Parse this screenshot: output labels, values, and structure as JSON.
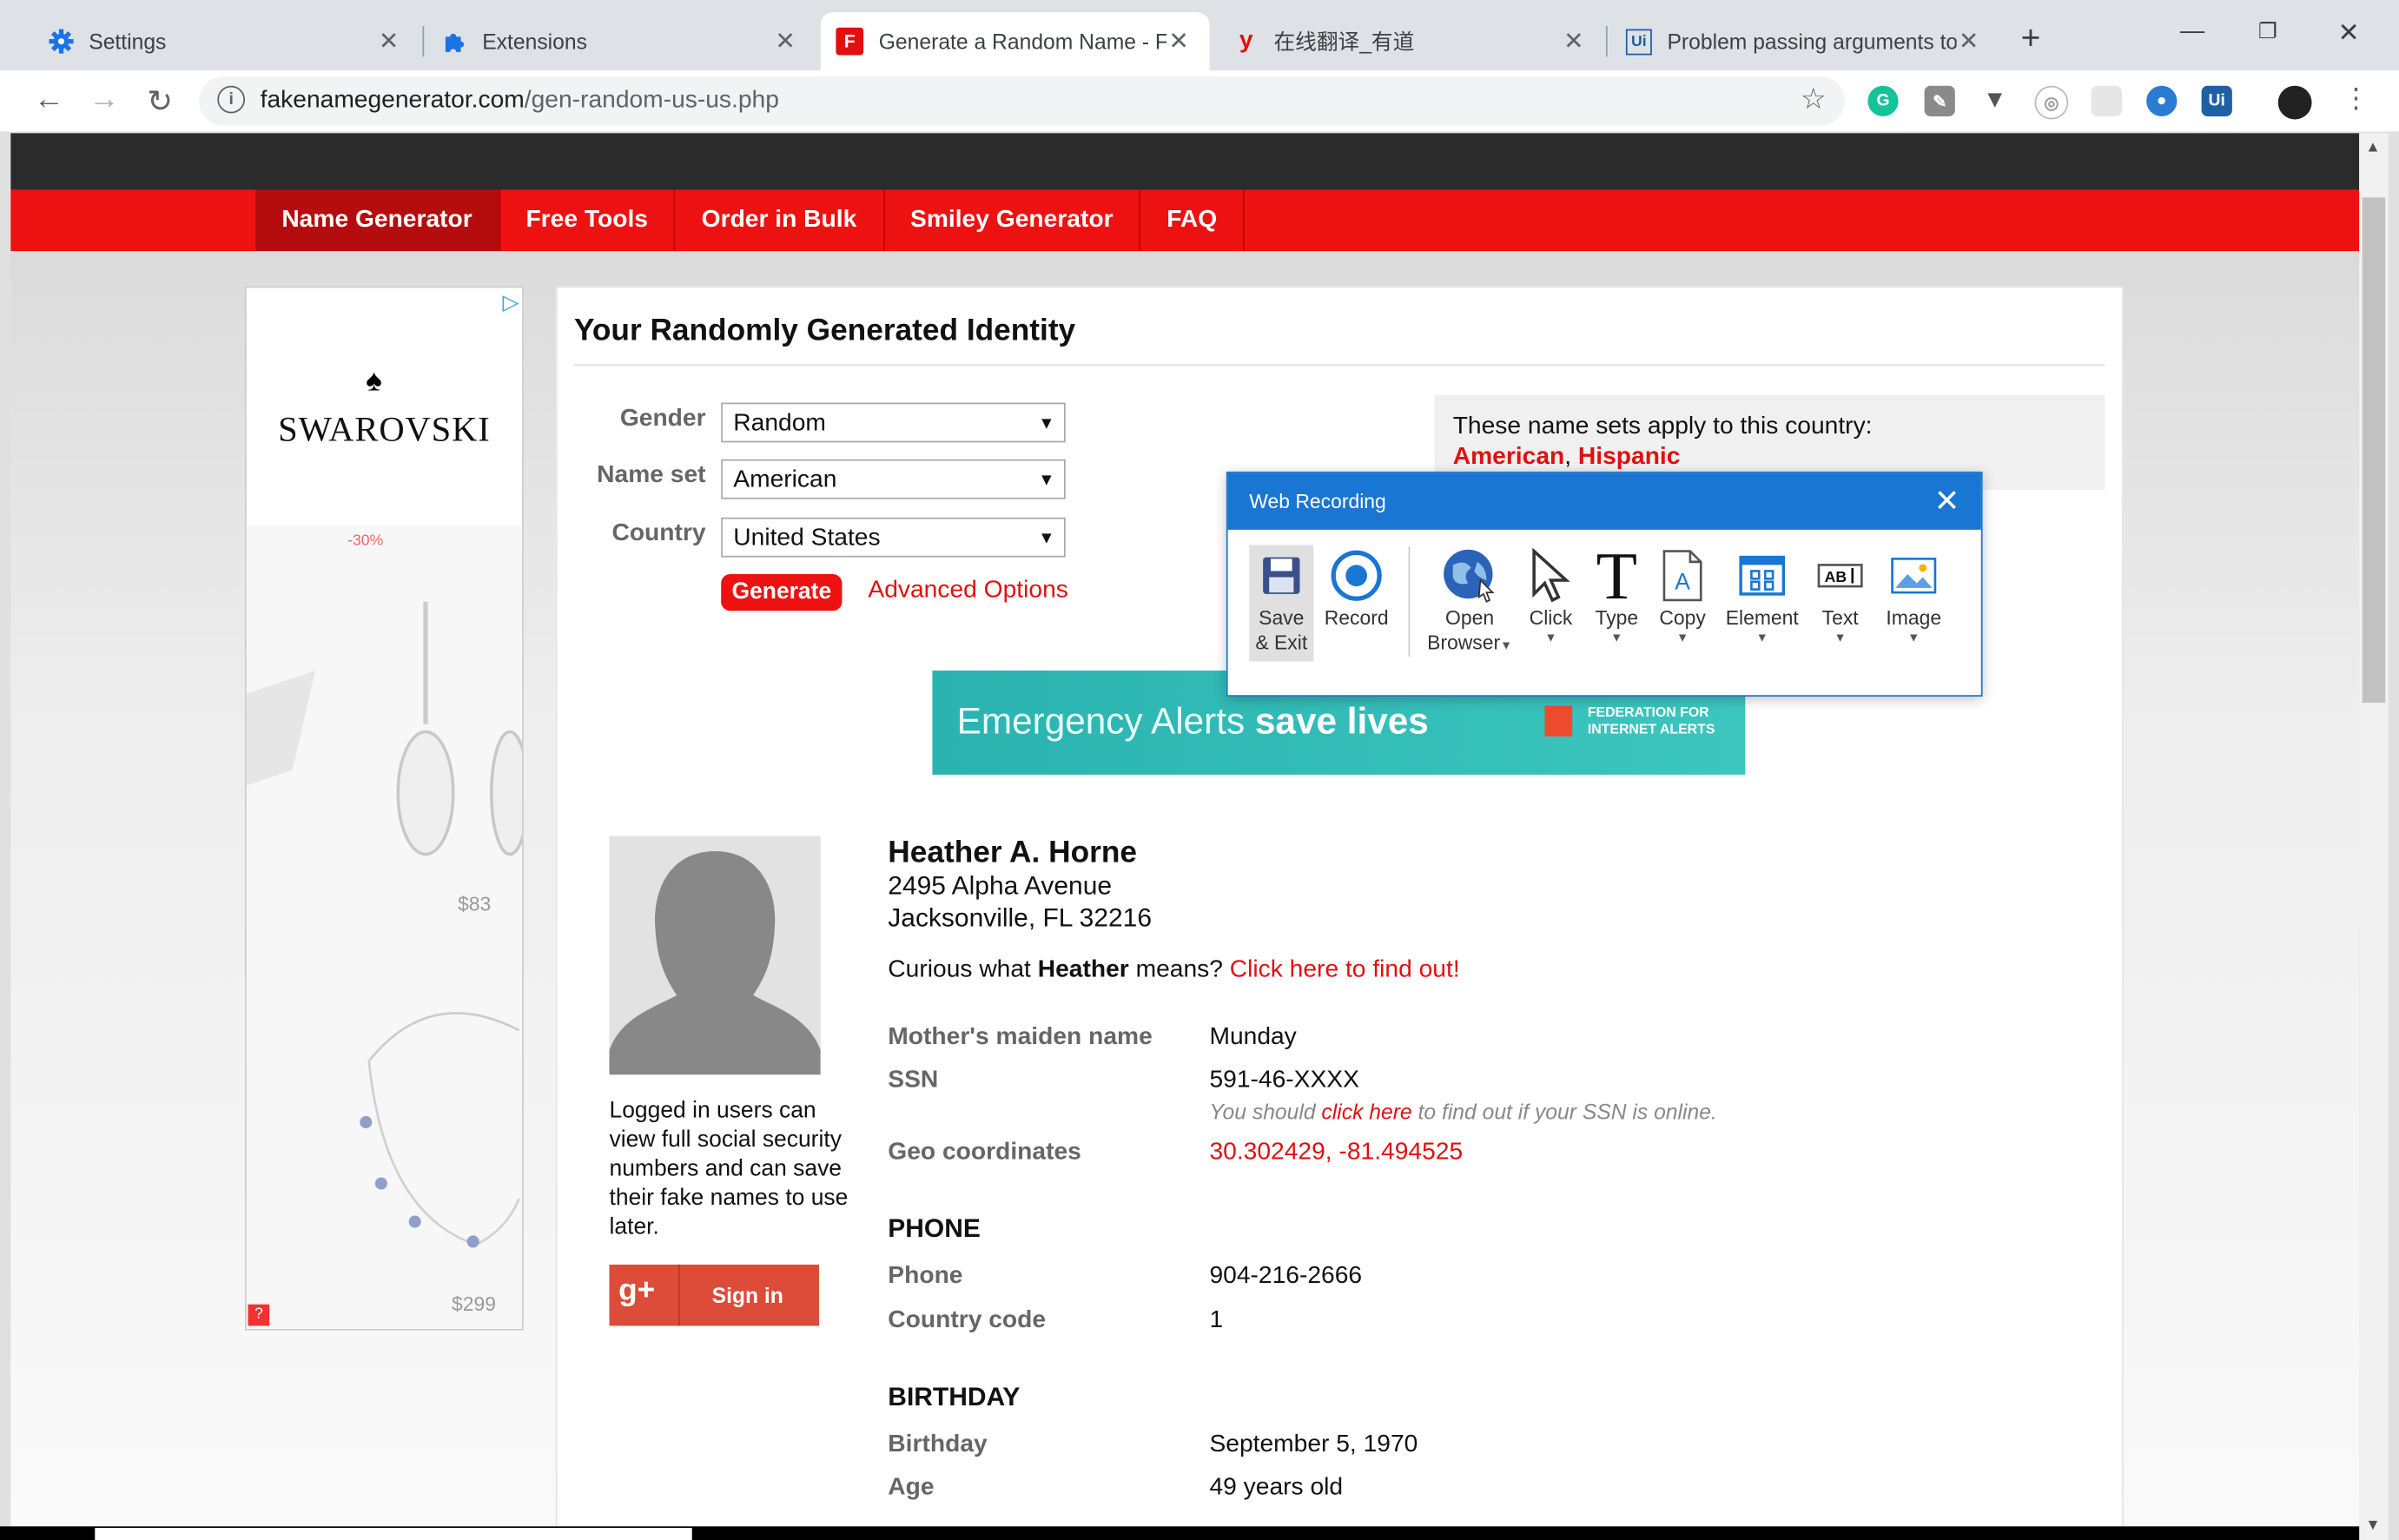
{
  "browser": {
    "tabs": [
      {
        "title": "Settings",
        "icon": "gear-icon"
      },
      {
        "title": "Extensions",
        "icon": "puzzle-icon"
      },
      {
        "title": "Generate a Random Name - Fa",
        "icon": "fakename-icon"
      },
      {
        "title": "在线翻译_有道",
        "icon": "youdao-icon"
      },
      {
        "title": "Problem passing arguments to",
        "icon": "uipath-icon"
      }
    ],
    "url_host": "fakenamegenerator.com",
    "url_path": "/gen-random-us-us.php"
  },
  "site": {
    "menu": [
      "Name Generator",
      "Free Tools",
      "Order in Bulk",
      "Smiley Generator",
      "FAQ"
    ]
  },
  "ad": {
    "brand": "SWAROVSKI",
    "discount": "-30%",
    "price1": "$83",
    "price2": "$299",
    "help": "?"
  },
  "form": {
    "title": "Your Randomly Generated Identity",
    "gender_label": "Gender",
    "gender_value": "Random",
    "nameset_label": "Name set",
    "nameset_value": "American",
    "country_label": "Country",
    "country_value": "United States",
    "generate_label": "Generate",
    "advanced_label": "Advanced Options",
    "namesets_note": "These name sets apply to this country:",
    "nameset_link1": "American",
    "nameset_sep": ", ",
    "nameset_link2": "Hispanic"
  },
  "banner": {
    "text_a": "Emergency Alerts ",
    "text_b": "save lives",
    "org_line1": "FEDERATION FOR",
    "org_line2": "INTERNET ALERTS"
  },
  "identity": {
    "name": "Heather A. Horne",
    "street": "2495 Alpha Avenue",
    "city": "Jacksonville, FL 32216",
    "curious_pre": "Curious what ",
    "curious_name": "Heather",
    "curious_post": " means? ",
    "curious_link": "Click here to find out!",
    "logged_note": "Logged in users can view full social security numbers and can save their fake names to use later.",
    "signin": "Sign in",
    "gplus": "g+",
    "maiden_label": "Mother's maiden name",
    "maiden_value": "Munday",
    "ssn_label": "SSN",
    "ssn_value": "591-46-XXXX",
    "ssn_note_pre": "You should ",
    "ssn_note_link": "click here",
    "ssn_note_post": " to find out if your SSN is online.",
    "geo_label": "Geo coordinates",
    "geo_value": "30.302429, -81.494525",
    "phone_section": "PHONE",
    "phone_label": "Phone",
    "phone_value": "904-216-2666",
    "cc_label": "Country code",
    "cc_value": "1",
    "birthday_section": "BIRTHDAY",
    "birthday_label": "Birthday",
    "birthday_value": "September 5, 1970",
    "age_label": "Age",
    "age_value": "49 years old"
  },
  "recorder": {
    "title": "Web Recording",
    "buttons": [
      {
        "line1": "Save",
        "line2": "& Exit"
      },
      {
        "line1": "Record"
      },
      {
        "line1": "Open",
        "line2": "Browser"
      },
      {
        "line1": "Click"
      },
      {
        "line1": "Type"
      },
      {
        "line1": "Copy"
      },
      {
        "line1": "Element"
      },
      {
        "line1": "Text"
      },
      {
        "line1": "Image"
      }
    ]
  }
}
